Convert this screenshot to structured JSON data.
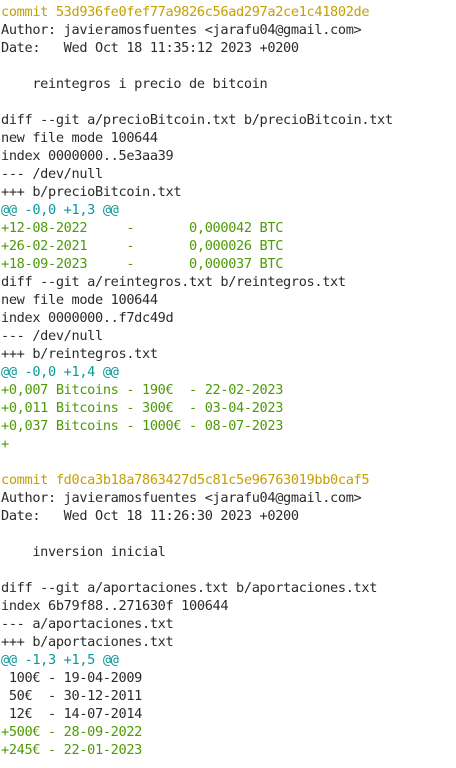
{
  "colors": {
    "commit": "#c4a000",
    "hunk": "#06989a",
    "added": "#4e9a06",
    "text": "#2b2b2b",
    "background": "#ffffff"
  },
  "log": [
    {
      "type": "commit",
      "text": "commit 53d936fe0fef77a9826c56ad297a2ce1c41802de"
    },
    {
      "type": "meta",
      "text": "Author: javieramosfuentes <jarafu04@gmail.com>"
    },
    {
      "type": "meta",
      "text": "Date:   Wed Oct 18 11:35:12 2023 +0200"
    },
    {
      "type": "blank",
      "text": ""
    },
    {
      "type": "msg",
      "text": "    reintegros i precio de bitcoin"
    },
    {
      "type": "blank",
      "text": ""
    },
    {
      "type": "meta",
      "text": "diff --git a/precioBitcoin.txt b/precioBitcoin.txt"
    },
    {
      "type": "meta",
      "text": "new file mode 100644"
    },
    {
      "type": "meta",
      "text": "index 0000000..5e3aa39"
    },
    {
      "type": "meta",
      "text": "--- /dev/null"
    },
    {
      "type": "meta",
      "text": "+++ b/precioBitcoin.txt"
    },
    {
      "type": "hunk",
      "text": "@@ -0,0 +1,3 @@"
    },
    {
      "type": "added",
      "text": "+12-08-2022     -       0,000042 BTC"
    },
    {
      "type": "added",
      "text": "+26-02-2021     -       0,000026 BTC"
    },
    {
      "type": "added",
      "text": "+18-09-2023     -       0,000037 BTC"
    },
    {
      "type": "meta",
      "text": "diff --git a/reintegros.txt b/reintegros.txt"
    },
    {
      "type": "meta",
      "text": "new file mode 100644"
    },
    {
      "type": "meta",
      "text": "index 0000000..f7dc49d"
    },
    {
      "type": "meta",
      "text": "--- /dev/null"
    },
    {
      "type": "meta",
      "text": "+++ b/reintegros.txt"
    },
    {
      "type": "hunk",
      "text": "@@ -0,0 +1,4 @@"
    },
    {
      "type": "added",
      "text": "+0,007 Bitcoins - 190€  - 22-02-2023"
    },
    {
      "type": "added",
      "text": "+0,011 Bitcoins - 300€  - 03-04-2023"
    },
    {
      "type": "added",
      "text": "+0,037 Bitcoins - 1000€ - 08-07-2023"
    },
    {
      "type": "added",
      "text": "+"
    },
    {
      "type": "blank",
      "text": ""
    },
    {
      "type": "commit",
      "text": "commit fd0ca3b18a7863427d5c81c5e96763019bb0caf5"
    },
    {
      "type": "meta",
      "text": "Author: javieramosfuentes <jarafu04@gmail.com>"
    },
    {
      "type": "meta",
      "text": "Date:   Wed Oct 18 11:26:30 2023 +0200"
    },
    {
      "type": "blank",
      "text": ""
    },
    {
      "type": "msg",
      "text": "    inversion inicial"
    },
    {
      "type": "blank",
      "text": ""
    },
    {
      "type": "meta",
      "text": "diff --git a/aportaciones.txt b/aportaciones.txt"
    },
    {
      "type": "meta",
      "text": "index 6b79f88..271630f 100644"
    },
    {
      "type": "meta",
      "text": "--- a/aportaciones.txt"
    },
    {
      "type": "meta",
      "text": "+++ b/aportaciones.txt"
    },
    {
      "type": "hunk",
      "text": "@@ -1,3 +1,5 @@"
    },
    {
      "type": "ctx",
      "text": " 100€ - 19-04-2009"
    },
    {
      "type": "ctx",
      "text": " 50€  - 30-12-2011"
    },
    {
      "type": "ctx",
      "text": " 12€  - 14-07-2014"
    },
    {
      "type": "added",
      "text": "+500€ - 28-09-2022"
    },
    {
      "type": "added",
      "text": "+245€ - 22-01-2023"
    }
  ]
}
